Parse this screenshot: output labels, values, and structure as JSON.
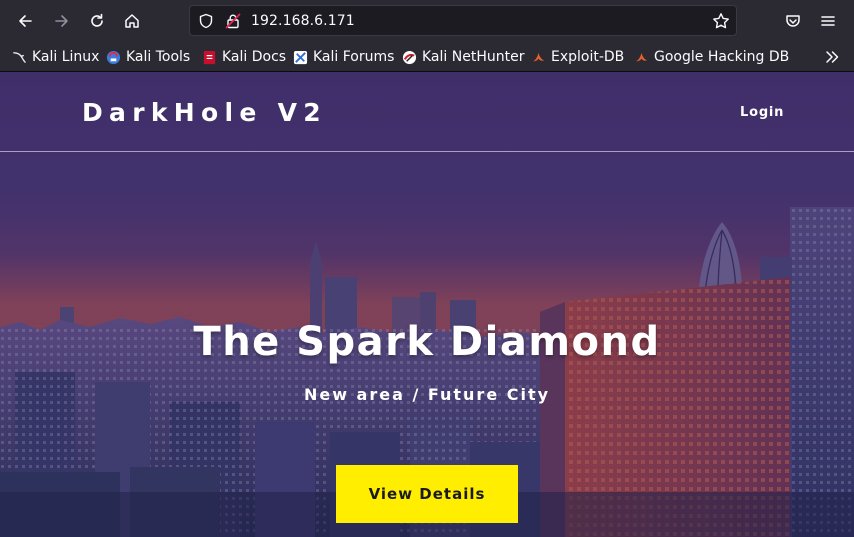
{
  "browser": {
    "url": "192.168.6.171",
    "bookmarks": [
      {
        "label": "Kali Linux",
        "icon": "kali-dragon-icon"
      },
      {
        "label": "Kali Tools",
        "icon": "kali-tools-icon"
      },
      {
        "label": "Kali Docs",
        "icon": "kali-docs-icon"
      },
      {
        "label": "Kali Forums",
        "icon": "kali-forums-icon"
      },
      {
        "label": "Kali NetHunter",
        "icon": "kali-nethunter-icon"
      },
      {
        "label": "Exploit-DB",
        "icon": "exploit-db-icon"
      },
      {
        "label": "Google Hacking DB",
        "icon": "ghdb-icon"
      }
    ]
  },
  "site": {
    "brand": "DarkHole V2",
    "login_label": "Login",
    "hero_title": "The Spark Diamond",
    "hero_subtitle": "New area / Future City",
    "cta_label": "View Details"
  },
  "colors": {
    "toolbar": "#2b2a33",
    "urlbar": "#1c1b22",
    "cta": "#ffee00",
    "text": "#fbfbfe"
  }
}
